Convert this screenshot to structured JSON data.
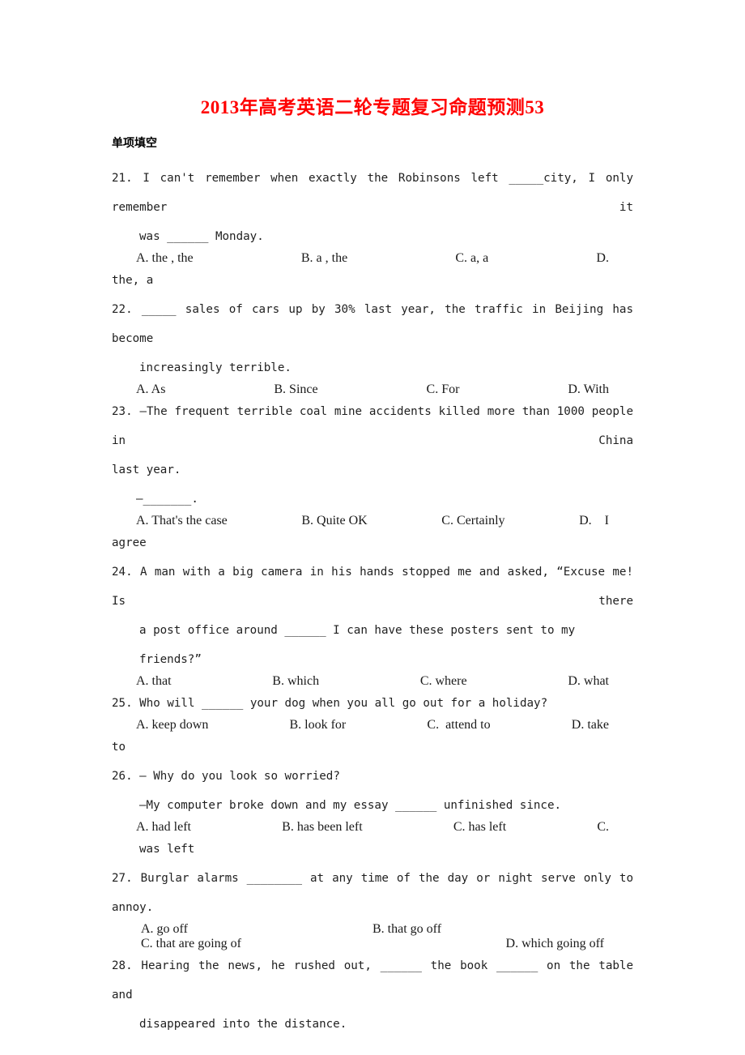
{
  "document": {
    "title": "2013年高考英语二轮专题复习命题预测53",
    "title_color": "#ff0000",
    "section_heading": "单项填空"
  },
  "questions": [
    {
      "number": "21.",
      "stem_line_1": "21. I can't remember when exactly the Robinsons left _____city, I only remember it",
      "stem_line_2": "was ______ Monday.",
      "options_row_1": [
        "A. the , the",
        "B. a , the",
        "C. a, a",
        "D."
      ],
      "options_row_2": [
        "the, a"
      ]
    },
    {
      "number": "22.",
      "stem_line_1": "22. _____ sales of cars up by 30% last year, the traffic in Beijing has become",
      "stem_line_2": "increasingly terrible.",
      "options_row_1": [
        "A. As",
        "B. Since",
        "C. For",
        "D. With"
      ]
    },
    {
      "number": "23.",
      "stem_line_1": "23. —The frequent terrible coal mine accidents killed more than 1000 people in China",
      "stem_line_2": "last year.",
      "stem_line_3": "—_______.",
      "options_row_1": [
        "A. That's the case",
        "B. Quite OK",
        "C. Certainly",
        "D.    I"
      ],
      "options_row_2": [
        "agree"
      ]
    },
    {
      "number": "24.",
      "stem_line_1": "24. A man with a big camera in his hands stopped me and asked, “Excuse me! Is there",
      "stem_line_2": "a post office around ______ I can have these posters sent to my friends?”",
      "options_row_1": [
        "A. that",
        "B. which",
        "C. where",
        "D. what"
      ]
    },
    {
      "number": "25.",
      "stem_line_1": "25. Who will ______ your dog when you all go out for a holiday?",
      "options_row_1": [
        "A. keep down",
        "B. look for",
        "C.  attend to",
        "D. take"
      ],
      "options_row_2": [
        "to"
      ]
    },
    {
      "number": "26.",
      "stem_line_1": "26. — Why do you look so worried?",
      "stem_line_2": "—My computer broke down and my essay ______ unfinished since.",
      "options_row_1": [
        "A. had left",
        "B. has been left",
        "C. has left",
        "C."
      ],
      "options_row_2": [
        "was left"
      ]
    },
    {
      "number": "27.",
      "stem_line_1": "27. Burglar alarms ________ at any time of the day or night serve only to annoy.",
      "options_pair_1": [
        "A. go off",
        "B. that go off"
      ],
      "options_pair_2": [
        "C. that are going of",
        "D. which going off"
      ]
    },
    {
      "number": "28.",
      "stem_line_1": "28. Hearing the news, he rushed out, ______ the book ______ on the table and",
      "stem_line_2": "disappeared into the distance."
    }
  ]
}
